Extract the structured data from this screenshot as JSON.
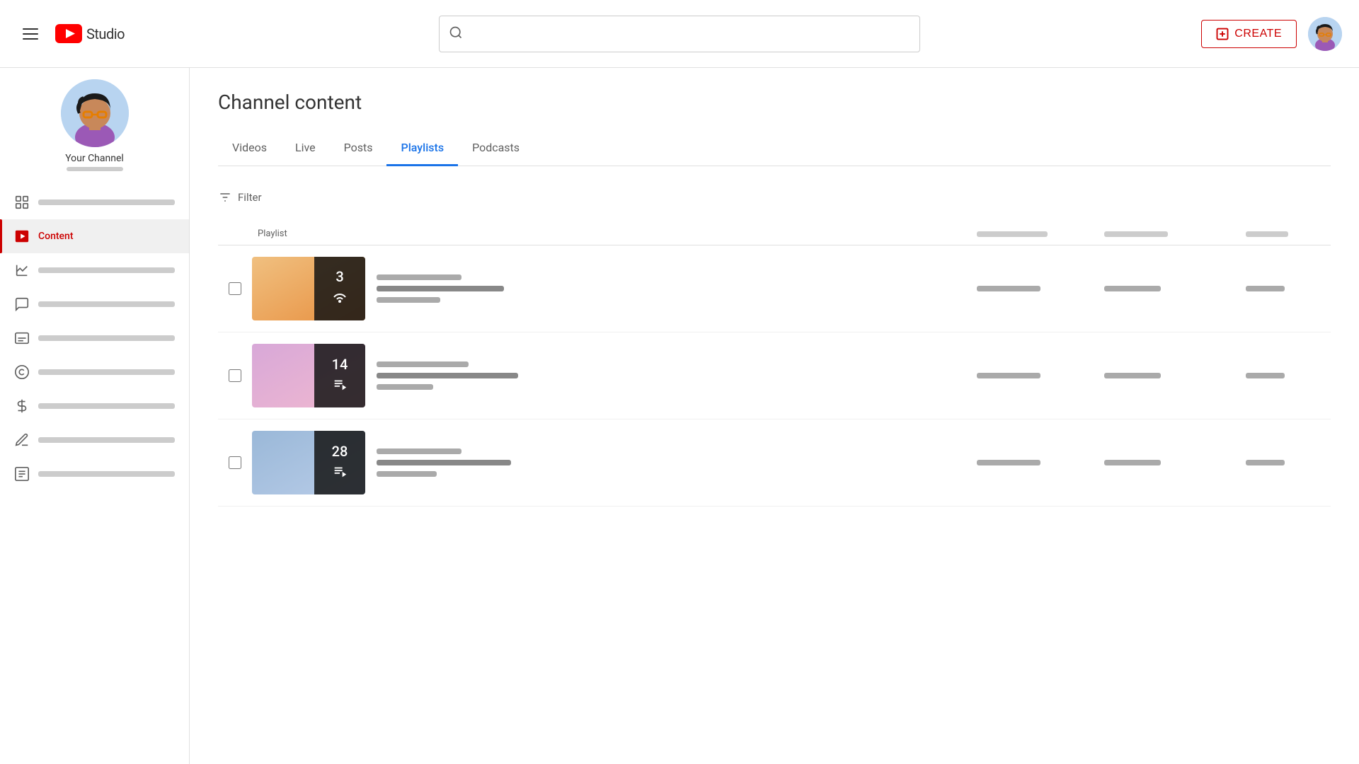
{
  "header": {
    "menu_icon": "hamburger-icon",
    "logo_text": "Studio",
    "search_placeholder": "",
    "create_label": "CREATE",
    "avatar_alt": "user-avatar"
  },
  "sidebar": {
    "channel_name": "Your Channel",
    "items": [
      {
        "id": "dashboard",
        "label": "",
        "icon": "dashboard-icon",
        "active": false
      },
      {
        "id": "content",
        "label": "Content",
        "icon": "content-icon",
        "active": true
      },
      {
        "id": "analytics",
        "label": "",
        "icon": "analytics-icon",
        "active": false
      },
      {
        "id": "comments",
        "label": "",
        "icon": "comments-icon",
        "active": false
      },
      {
        "id": "subtitles",
        "label": "",
        "icon": "subtitles-icon",
        "active": false
      },
      {
        "id": "copyright",
        "label": "",
        "icon": "copyright-icon",
        "active": false
      },
      {
        "id": "monetization",
        "label": "",
        "icon": "monetization-icon",
        "active": false
      },
      {
        "id": "customization",
        "label": "",
        "icon": "customization-icon",
        "active": false
      },
      {
        "id": "audiolib",
        "label": "",
        "icon": "audiolib-icon",
        "active": false
      }
    ]
  },
  "main": {
    "page_title": "Channel content",
    "tabs": [
      {
        "id": "videos",
        "label": "Videos",
        "active": false
      },
      {
        "id": "live",
        "label": "Live",
        "active": false
      },
      {
        "id": "posts",
        "label": "Posts",
        "active": false
      },
      {
        "id": "playlists",
        "label": "Playlists",
        "active": true
      },
      {
        "id": "podcasts",
        "label": "Podcasts",
        "active": false
      }
    ],
    "filter_label": "Filter",
    "table_header": {
      "playlist_col": "Playlist"
    },
    "playlists": [
      {
        "id": 1,
        "count": "3",
        "icon": "podcast-icon",
        "gradient_start": "#f0c080",
        "gradient_end": "#e8a060"
      },
      {
        "id": 2,
        "count": "14",
        "icon": "playlist-icon",
        "gradient_start": "#d8b0d8",
        "gradient_end": "#e0a0c0"
      },
      {
        "id": 3,
        "count": "28",
        "icon": "playlist-icon",
        "gradient_start": "#a0b8d8",
        "gradient_end": "#b0c8e8"
      }
    ]
  }
}
